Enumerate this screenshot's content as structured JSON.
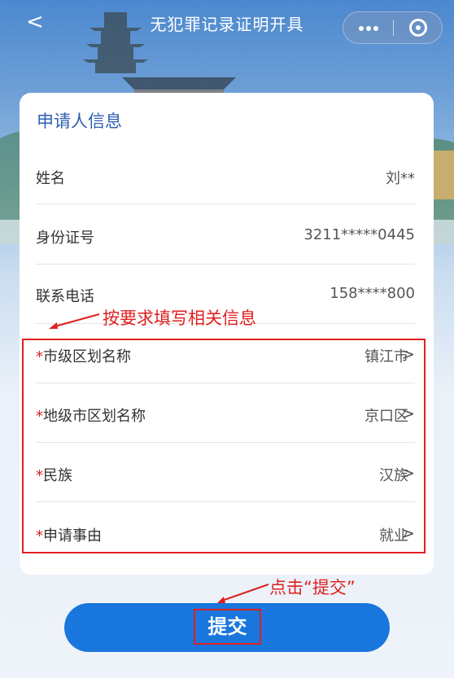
{
  "header": {
    "back_icon": "<",
    "title": "无犯罪记录证明开具",
    "more_icon": "more-dots-icon",
    "close_icon": "miniprogram-close-icon"
  },
  "card": {
    "title": "申请人信息",
    "rows": [
      {
        "label": "姓名",
        "value": "刘**"
      },
      {
        "label": "身份证号",
        "value": "3211*****0445"
      },
      {
        "label": "联系电话",
        "value": "158****800"
      }
    ],
    "select_rows": [
      {
        "required_mark": "*",
        "label": "市级区划名称",
        "value": "镇江市",
        "chevron": ">"
      },
      {
        "required_mark": "*",
        "label": "地级市区划名称",
        "value": "京口区",
        "chevron": ">"
      },
      {
        "required_mark": "*",
        "label": "民族",
        "value": "汉族",
        "chevron": ">"
      },
      {
        "required_mark": "*",
        "label": "申请事由",
        "value": "就业",
        "chevron": ">"
      }
    ]
  },
  "annotations": {
    "fill_note": "按要求填写相关信息",
    "submit_note": "点击“提交”",
    "color": "#e01f1f"
  },
  "submit_label": "提交",
  "colors": {
    "primary": "#1976dd",
    "title_blue": "#2e5fb3"
  }
}
